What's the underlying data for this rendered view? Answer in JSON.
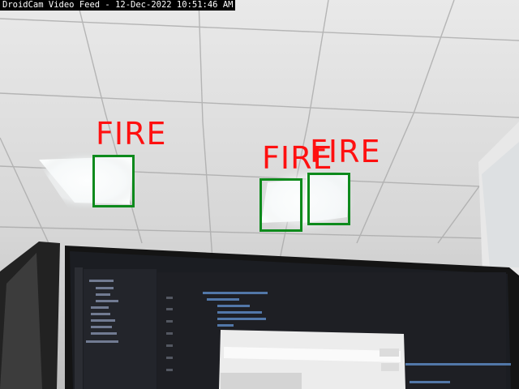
{
  "window": {
    "title": "DroidCam Video Feed - 12-Dec-2022 10:51:46 AM"
  },
  "detections": [
    {
      "label": "FIRE"
    },
    {
      "label": "FIRE"
    },
    {
      "label": "FIRE"
    }
  ],
  "colors": {
    "box": "#0d8a1c",
    "label": "#ff1010",
    "title_bg": "#000000"
  }
}
